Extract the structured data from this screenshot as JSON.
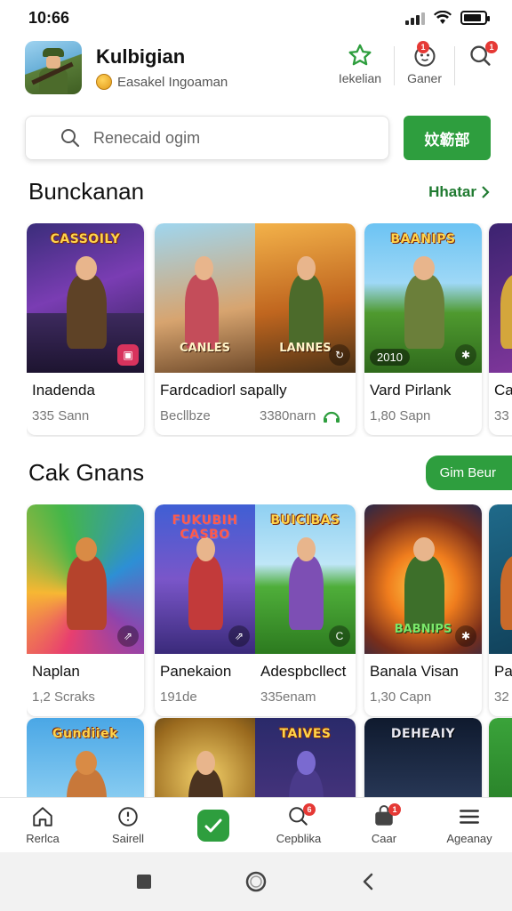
{
  "status": {
    "time": "10:66"
  },
  "header": {
    "title": "Kulbigian",
    "subtitle": "Easakel Ingoaman",
    "actions": [
      {
        "label": "Iekelian",
        "icon": "star-outline-icon"
      },
      {
        "label": "Ganer",
        "icon": "face-icon",
        "badge": "1"
      },
      {
        "label": "",
        "icon": "search-icon",
        "badge": "1"
      }
    ]
  },
  "search": {
    "placeholder": "Renecaid ogim",
    "button": "enter-button",
    "button_label": "妏簕部"
  },
  "section1": {
    "title": "Bunckanan",
    "see_more": "Hhatar",
    "cards": [
      {
        "type": "std",
        "art": [
          {
            "logo": "CASSOILY",
            "theme": "purple"
          }
        ],
        "name": "Inadenda",
        "meta": "335 Sann"
      },
      {
        "type": "wide",
        "art": [
          {
            "logo": "",
            "bottom": "CANLES",
            "theme": "sky"
          },
          {
            "logo": "",
            "bottom": "LANNES",
            "theme": "orange"
          }
        ],
        "name": "Fardcadiorl sapally",
        "meta_left": "Becllbze",
        "meta_right": "3380narn"
      },
      {
        "type": "std",
        "art": [
          {
            "logo": "BAANIPS",
            "theme": "green",
            "pill": "2010"
          }
        ],
        "name": "Vard Pirlank",
        "meta": "1,80 Sapn"
      },
      {
        "type": "std",
        "art": [
          {
            "logo": "",
            "theme": "purple"
          }
        ],
        "name": "Car",
        "meta": "33"
      }
    ]
  },
  "section2": {
    "title": "Cak Gnans",
    "button": "Gim Beur",
    "cards": [
      {
        "type": "std",
        "art": [
          {
            "logo": "",
            "theme": "rainbow"
          }
        ],
        "name": "Naplan",
        "meta": "1,2 Scraks"
      },
      {
        "type": "wide",
        "art": [
          {
            "logo": "FUKUBIH CASBO",
            "theme": "blue"
          },
          {
            "logo": "BUICIBAS",
            "theme": "field"
          }
        ],
        "name_left": "Panekaion",
        "name_right": "Adespbcllect",
        "meta_left": "191de",
        "meta_right": "335enam"
      },
      {
        "type": "std",
        "art": [
          {
            "logo": "",
            "bottom": "BABNIPS",
            "theme": "fire"
          }
        ],
        "name": "Banala Visan",
        "meta": "1,30 Capn"
      },
      {
        "type": "std",
        "art": [
          {
            "logo": "",
            "theme": "teal"
          }
        ],
        "name": "Pa",
        "meta": "32"
      }
    ]
  },
  "section3": {
    "cards": [
      {
        "type": "std",
        "art": [
          {
            "logo": "Gundiiek",
            "theme": "sky"
          }
        ]
      },
      {
        "type": "wide",
        "art": [
          {
            "logo": "",
            "theme": "gold"
          },
          {
            "logo": "TAIVES",
            "theme": "night"
          }
        ]
      },
      {
        "type": "std",
        "art": [
          {
            "logo": "DEHEAIY",
            "theme": "dark"
          }
        ]
      },
      {
        "type": "std",
        "art": [
          {
            "logo": "",
            "theme": "green"
          }
        ]
      }
    ]
  },
  "bottom_nav": [
    {
      "label": "Rerlca",
      "icon": "home-icon"
    },
    {
      "label": "Sairell",
      "icon": "clock-icon"
    },
    {
      "label": "",
      "icon": "check-icon"
    },
    {
      "label": "Cepblika",
      "icon": "search-icon",
      "badge": "6"
    },
    {
      "label": "Caar",
      "icon": "bag-icon",
      "badge": "1"
    },
    {
      "label": "Ageanay",
      "icon": "menu-icon"
    }
  ]
}
